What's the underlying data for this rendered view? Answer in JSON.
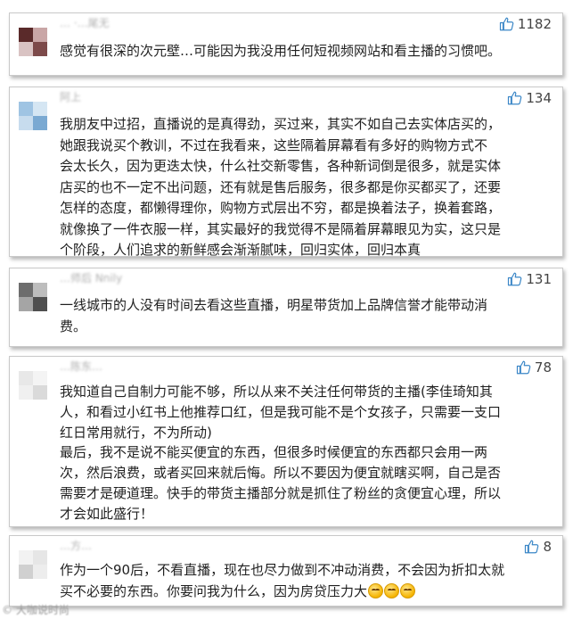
{
  "comments": [
    {
      "username": "… ·…尾无",
      "likes": "1182",
      "text": "感觉有很深的次元壁…可能因为我没用任何短视频网站和看主播的习惯吧。",
      "emoji_count": 0
    },
    {
      "username": "阿上",
      "likes": "134",
      "text": "我朋友中过招，直播说的是真得劲，买过来，其实不如自己去实体店买的，\n她跟我说买个教训，不过在我看来，这些隔着屏幕看有多好的购物方式不\n会太长久，因为更迭太快，什么社交新零售，各种新词倒是很多，就是实体\n店买的也不一定不出问题，还有就是售后服务，很多都是你买都买了，还要\n怎样的态度，都懒得理你，购物方式层出不穷，都是换着法子，换着套路，\n就像换了一件衣服一样，其实最好的我觉得不是隔着屏幕眼见为实，这只是\n个阶段，人们追求的新鲜感会渐渐腻味，回归实体，回归本真",
      "emoji_count": 0
    },
    {
      "username": "…师后 Nnily",
      "likes": "131",
      "text": "一线城市的人没有时间去看这些直播，明星带货加上品牌信誉才能带动消\n费。",
      "emoji_count": 0
    },
    {
      "username": "…陈东…",
      "likes": "78",
      "text": "我知道自己自制力可能不够，所以从来不关注任何带货的主播(李佳琦知其\n人，和看过小红书上他推荐口红，但是我可能不是个女孩子，只需要一支口\n红日常用就行，不为所动)\n最后，我不是说不能买便宜的东西，但很多时候便宜的东西都只会用一两\n次，然后浪费，或者买回来就后悔。所以不要因为便宜就瞎买啊，自己是否\n需要才是硬道理。快手的带货主播部分就是抓住了粉丝的贪便宜心理，所以\n才会如此盛行！",
      "emoji_count": 0
    },
    {
      "username": "…方…",
      "likes": "8",
      "text": "作为一个90后，不看直播，现在也尽力做到不冲动消费，不会因为折扣太就\n买不必要的东西。你要问我为什么，因为房贷压力大",
      "emoji_count": 3
    }
  ],
  "watermark": "© 大咖说时尚"
}
